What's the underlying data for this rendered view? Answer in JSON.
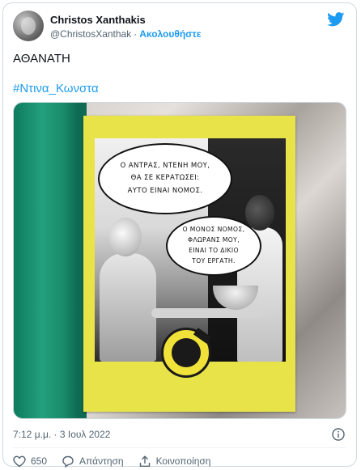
{
  "author": {
    "name": "Christos Xanthakis",
    "handle": "@ChristosXanthak",
    "separator": "·",
    "follow_label": "Ακολουθήστε"
  },
  "tweet": {
    "text": "ΑΘΑΝΑΤΗ",
    "hashtag": "#Ντινα_Κωνστα"
  },
  "media": {
    "bubble_1": [
      "Ο ΑΝΤΡΑΣ, ΝΤΕΝΗ ΜΟΥ,",
      "ΘΑ ΣΕ ΚΕΡΑΤΩΣΕΙ:",
      "ΑΥΤΟ ΕΙΝΑΙ ΝΟΜΟΣ."
    ],
    "bubble_2": [
      "Ο ΜΟΝΟΣ ΝΟΜΟΣ,",
      "ΦΛΩΡΑΝΣ ΜΟΥ,",
      "ΕΙΝΑΙ ΤΟ ΔΙΚΙΟ",
      "ΤΟΥ ΕΡΓΑΤΗ."
    ],
    "icon": "poster-photo"
  },
  "meta": {
    "timestamp": "7:12 μ.μ. · 3 Ιουλ 2022"
  },
  "actions": {
    "like_count": "650",
    "reply_label": "Απάντηση",
    "share_label": "Κοινοποίηση"
  },
  "colors": {
    "accent": "#1d9bf0",
    "text": "#0f1419",
    "secondary": "#536471",
    "poster_yellow": "#e9e34a",
    "post_green": "#1a8c6c"
  }
}
